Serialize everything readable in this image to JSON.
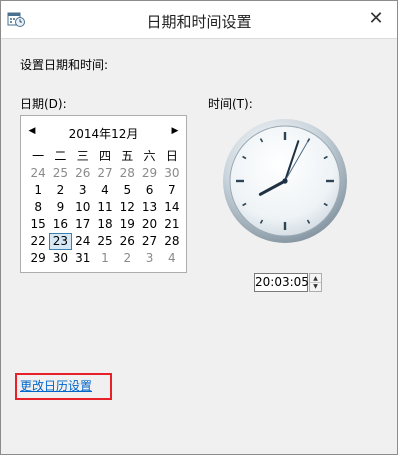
{
  "window": {
    "title": "日期和时间设置",
    "close_glyph": "✕",
    "app_icon": "calendar-clock-icon"
  },
  "heading": "设置日期和时间:",
  "date_label": "日期(D):",
  "time_label": "时间(T):",
  "calendar": {
    "month_title": "2014年12月",
    "prev_glyph": "◀",
    "next_glyph": "▶",
    "weekdays": [
      "一",
      "二",
      "三",
      "四",
      "五",
      "六",
      "日"
    ],
    "weeks": [
      [
        "24",
        "25",
        "26",
        "27",
        "28",
        "29",
        "30"
      ],
      [
        "1",
        "2",
        "3",
        "4",
        "5",
        "6",
        "7"
      ],
      [
        "8",
        "9",
        "10",
        "11",
        "12",
        "13",
        "14"
      ],
      [
        "15",
        "16",
        "17",
        "18",
        "19",
        "20",
        "21"
      ],
      [
        "22",
        "23",
        "24",
        "25",
        "26",
        "27",
        "28"
      ],
      [
        "29",
        "30",
        "31",
        "1",
        "2",
        "3",
        "4"
      ]
    ],
    "selected_day": "23"
  },
  "time": {
    "value": "20:03:05",
    "up_glyph": "▲",
    "down_glyph": "▼"
  },
  "change_calendar_link": "更改日历设置",
  "colors": {
    "accent_link": "#0066cc",
    "highlight_box": "#e8202a",
    "selected_day_border": "#3c7fb1"
  }
}
